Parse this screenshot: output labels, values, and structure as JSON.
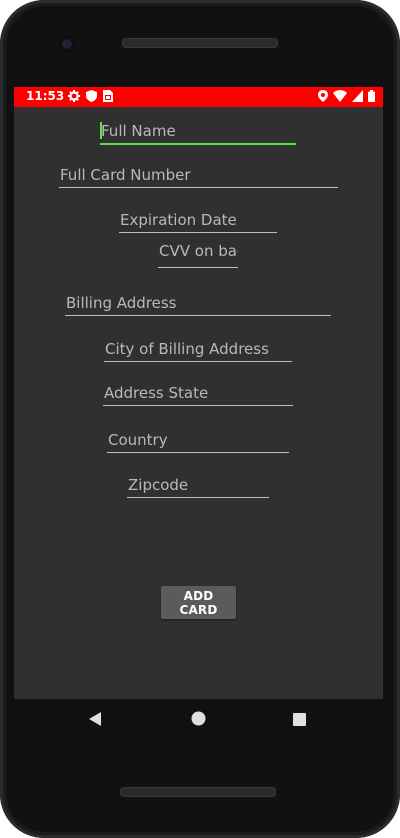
{
  "status_bar": {
    "time": "11:53",
    "bg_color": "#ff0000",
    "left_icons": [
      "gear-icon",
      "shield-icon",
      "sim-card-icon"
    ],
    "right_icons": [
      "location-icon",
      "wifi-icon",
      "signal-icon",
      "battery-icon"
    ]
  },
  "form": {
    "full_name": {
      "placeholder": "Full Name",
      "focused": true
    },
    "card_number": {
      "placeholder": "Full Card Number"
    },
    "expiration": {
      "placeholder": "Expiration Date"
    },
    "cvv": {
      "placeholder": "CVV on bac"
    },
    "billing_address": {
      "placeholder": "Billing Address"
    },
    "city": {
      "placeholder": "City of Billing Address"
    },
    "state": {
      "placeholder": "Address State"
    },
    "country": {
      "placeholder": "Country"
    },
    "zipcode": {
      "placeholder": "Zipcode"
    }
  },
  "add_card_button": {
    "label": "ADD CARD"
  },
  "colors": {
    "screen_bg": "#303030",
    "accent": "#5ee343",
    "button_bg": "#5b5b5b"
  },
  "nav": [
    "back-icon",
    "home-icon",
    "recents-icon"
  ]
}
